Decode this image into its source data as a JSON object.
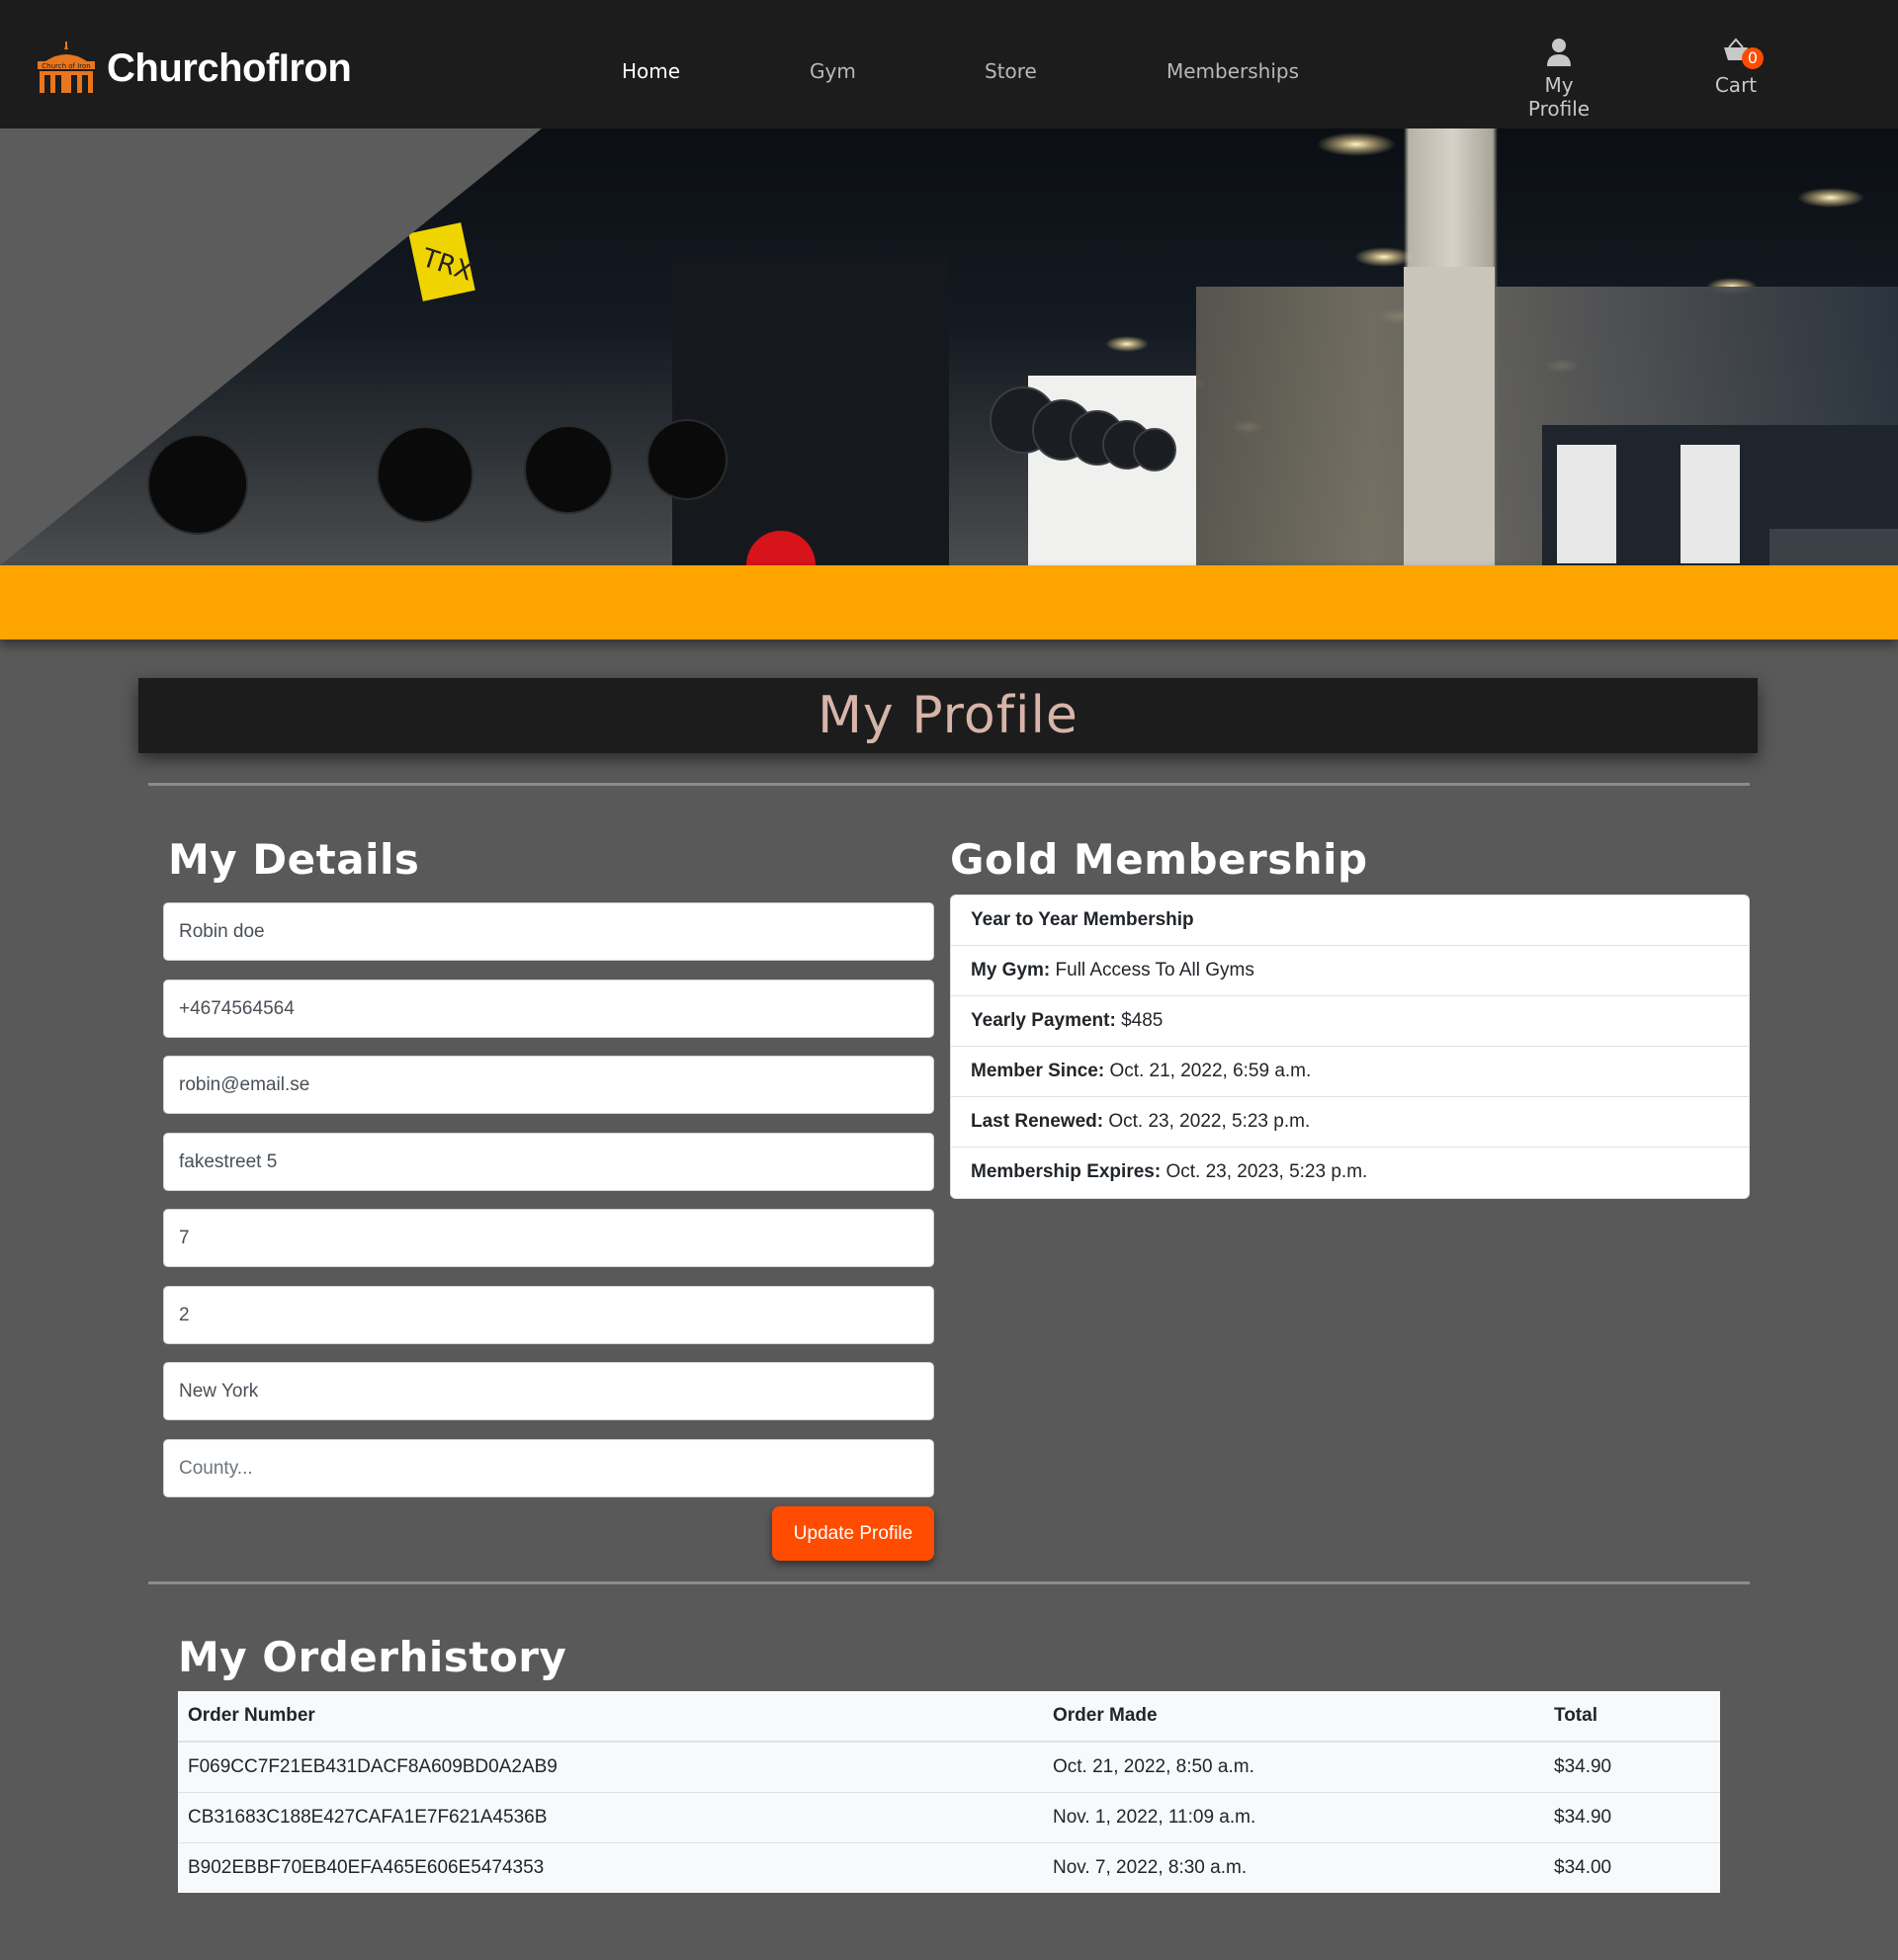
{
  "brand": {
    "logo_text": "Church of Iron",
    "name": "ChurchofIron"
  },
  "nav": {
    "links": [
      {
        "label": "Home",
        "active": true
      },
      {
        "label": "Gym",
        "active": false
      },
      {
        "label": "Store",
        "active": false
      },
      {
        "label": "Memberships",
        "active": false
      }
    ],
    "profile_label": "My Profile",
    "profile_icon": "user-icon",
    "cart_label": "Cart",
    "cart_icon": "basket-icon",
    "cart_count": "0"
  },
  "hero": {
    "sign_text": "TRX"
  },
  "colors": {
    "accent_orange": "#ffa500",
    "button_red": "#ff4c00",
    "navbar": "#1c1c1c",
    "background": "#595959",
    "title_text": "#d8b4a8"
  },
  "page_title": "My Profile",
  "details": {
    "heading": "My Details",
    "full_name": "Robin doe",
    "phone": "+4674564564",
    "email": "robin@email.se",
    "street_address1": "fakestreet 5",
    "street_address2": "7",
    "postcode": "2",
    "town_or_city": "New York",
    "county_placeholder": "County...",
    "update_button": "Update Profile"
  },
  "membership": {
    "heading": "Gold Membership",
    "rows": [
      {
        "label": "Year to Year Membership",
        "value": ""
      },
      {
        "label": "My Gym:",
        "value": "Full Access To All Gyms"
      },
      {
        "label": "Yearly Payment:",
        "value": "$485"
      },
      {
        "label": "Member Since:",
        "value": "Oct. 21, 2022, 6:59 a.m."
      },
      {
        "label": "Last Renewed:",
        "value": "Oct. 23, 2022, 5:23 p.m."
      },
      {
        "label": "Membership Expires:",
        "value": "Oct. 23, 2023, 5:23 p.m."
      }
    ]
  },
  "orders": {
    "heading": "My Orderhistory",
    "columns": [
      "Order Number",
      "Order Made",
      "Total"
    ],
    "rows": [
      {
        "number": "F069CC7F21EB431DACF8A609BD0A2AB9",
        "date": "Oct. 21, 2022, 8:50 a.m.",
        "total": "$34.90"
      },
      {
        "number": "CB31683C188E427CAFA1E7F621A4536B",
        "date": "Nov. 1, 2022, 11:09 a.m.",
        "total": "$34.90"
      },
      {
        "number": "B902EBBF70EB40EFA465E606E5474353",
        "date": "Nov. 7, 2022, 8:30 a.m.",
        "total": "$34.00"
      }
    ]
  }
}
